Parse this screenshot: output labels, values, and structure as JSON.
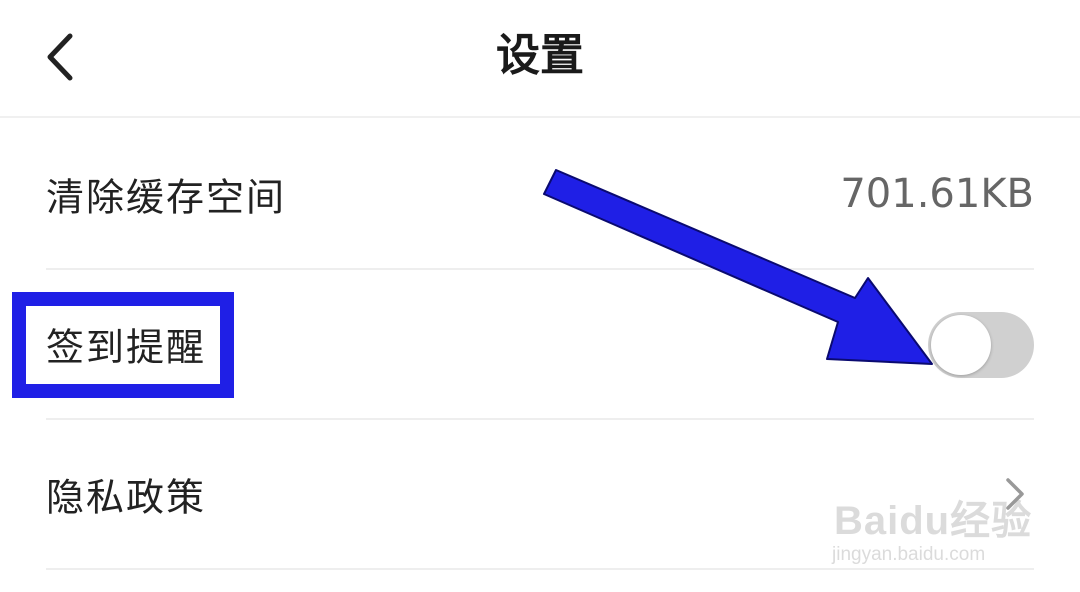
{
  "header": {
    "title": "设置",
    "back_icon": "chevron-left-icon"
  },
  "settings": [
    {
      "label": "清除缓存空间",
      "value": "701.61KB"
    },
    {
      "label": "签到提醒",
      "toggle_on": false
    },
    {
      "label": "隐私政策",
      "icon": "chevron-right-icon"
    }
  ],
  "annotation": {
    "highlight_color": "#1f1fe6",
    "arrow_color": "#1f1fe6"
  },
  "watermark": {
    "logo": "Baidu经验",
    "url": "jingyan.baidu.com"
  },
  "colors": {
    "toggle_off": "#d0d0d0",
    "title_text": "#1a1a1a",
    "value_text": "#666666"
  }
}
